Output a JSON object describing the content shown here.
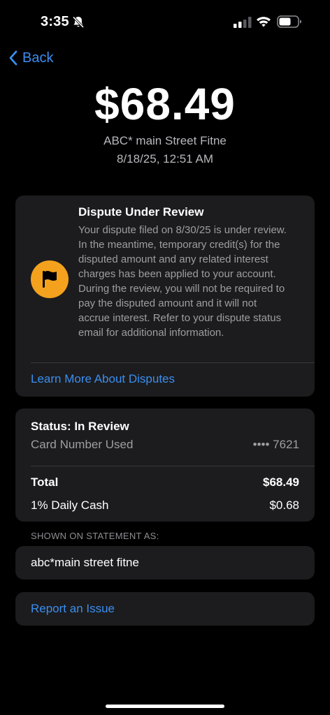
{
  "status_bar": {
    "time": "3:35"
  },
  "nav": {
    "back_label": "Back"
  },
  "transaction": {
    "amount": "$68.49",
    "merchant": "ABC* main Street Fitne",
    "datetime": "8/18/25, 12:51 AM"
  },
  "dispute": {
    "title": "Dispute Under Review",
    "body": "Your dispute filed on 8/30/25 is under review. In the meantime, temporary credit(s) for the disputed amount and any related interest charges has been applied to your account. During the review, you will not be required to pay the disputed amount and it will not accrue interest. Refer to your dispute status email for additional information.",
    "learn_more_label": "Learn More About Disputes",
    "accent_color": "#f4a21d"
  },
  "details": {
    "status": "Status: In Review",
    "card_number_label": "Card Number Used",
    "card_number_value": "•••• 7621",
    "total_label": "Total",
    "total_value": "$68.49",
    "cash_label": "1% Daily Cash",
    "cash_value": "$0.68"
  },
  "statement": {
    "header": "SHOWN ON STATEMENT AS:",
    "value": "abc*main street fitne"
  },
  "report": {
    "label": "Report an Issue"
  },
  "colors": {
    "link": "#3b8ef0",
    "card_bg": "#1c1c1e",
    "background": "#000000"
  }
}
